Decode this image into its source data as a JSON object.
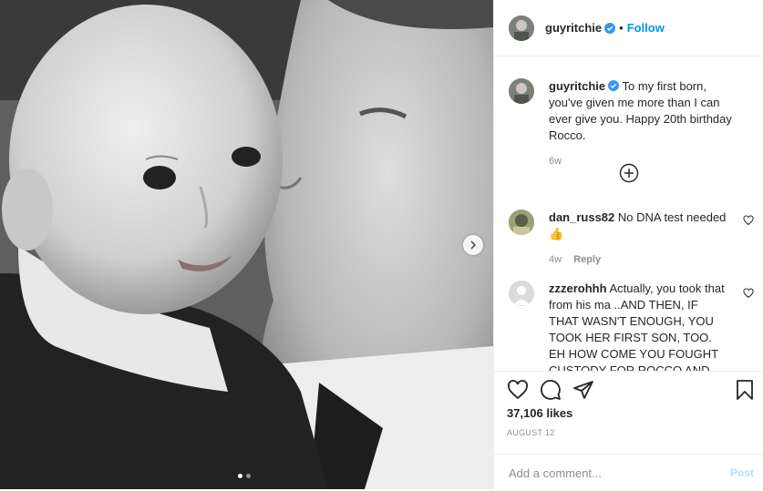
{
  "post": {
    "author": "guyritchie",
    "follow_label": "Follow",
    "separator": "•",
    "caption": "To my first born, you've given me more than I can ever give you. Happy 20th birthday Rocco.",
    "caption_age": "6w",
    "likes": "37,106 likes",
    "date": "AUGUST 12",
    "carousel": {
      "total": 2,
      "current": 1
    }
  },
  "comments": [
    {
      "user": "dan_russ82",
      "text": "No DNA test needed",
      "emoji": "👍",
      "age": "4w",
      "reply_label": "Reply"
    },
    {
      "user": "zzzerohhh",
      "text": "Actually, you took that from his ma ..AND THEN, IF THAT WASN'T ENOUGH, YOU TOOK HER FIRST SON, TOO. EH HOW COME YOU FOUGHT CUSTODY FOR ROCCO AND NOT DAVID?! IF"
    }
  ],
  "comment_box": {
    "placeholder": "Add a comment...",
    "post_label": "Post"
  },
  "icons": {
    "verified": "verified-badge-icon",
    "like": "heart-icon",
    "comment": "comment-bubble-icon",
    "share": "paper-plane-icon",
    "save": "bookmark-icon",
    "load_more": "plus-circle-icon",
    "next": "chevron-right-icon"
  },
  "colors": {
    "link": "#0095f6",
    "verified": "#3897f0",
    "muted": "#8e8e8e",
    "post_disabled": "#b2dffc"
  }
}
